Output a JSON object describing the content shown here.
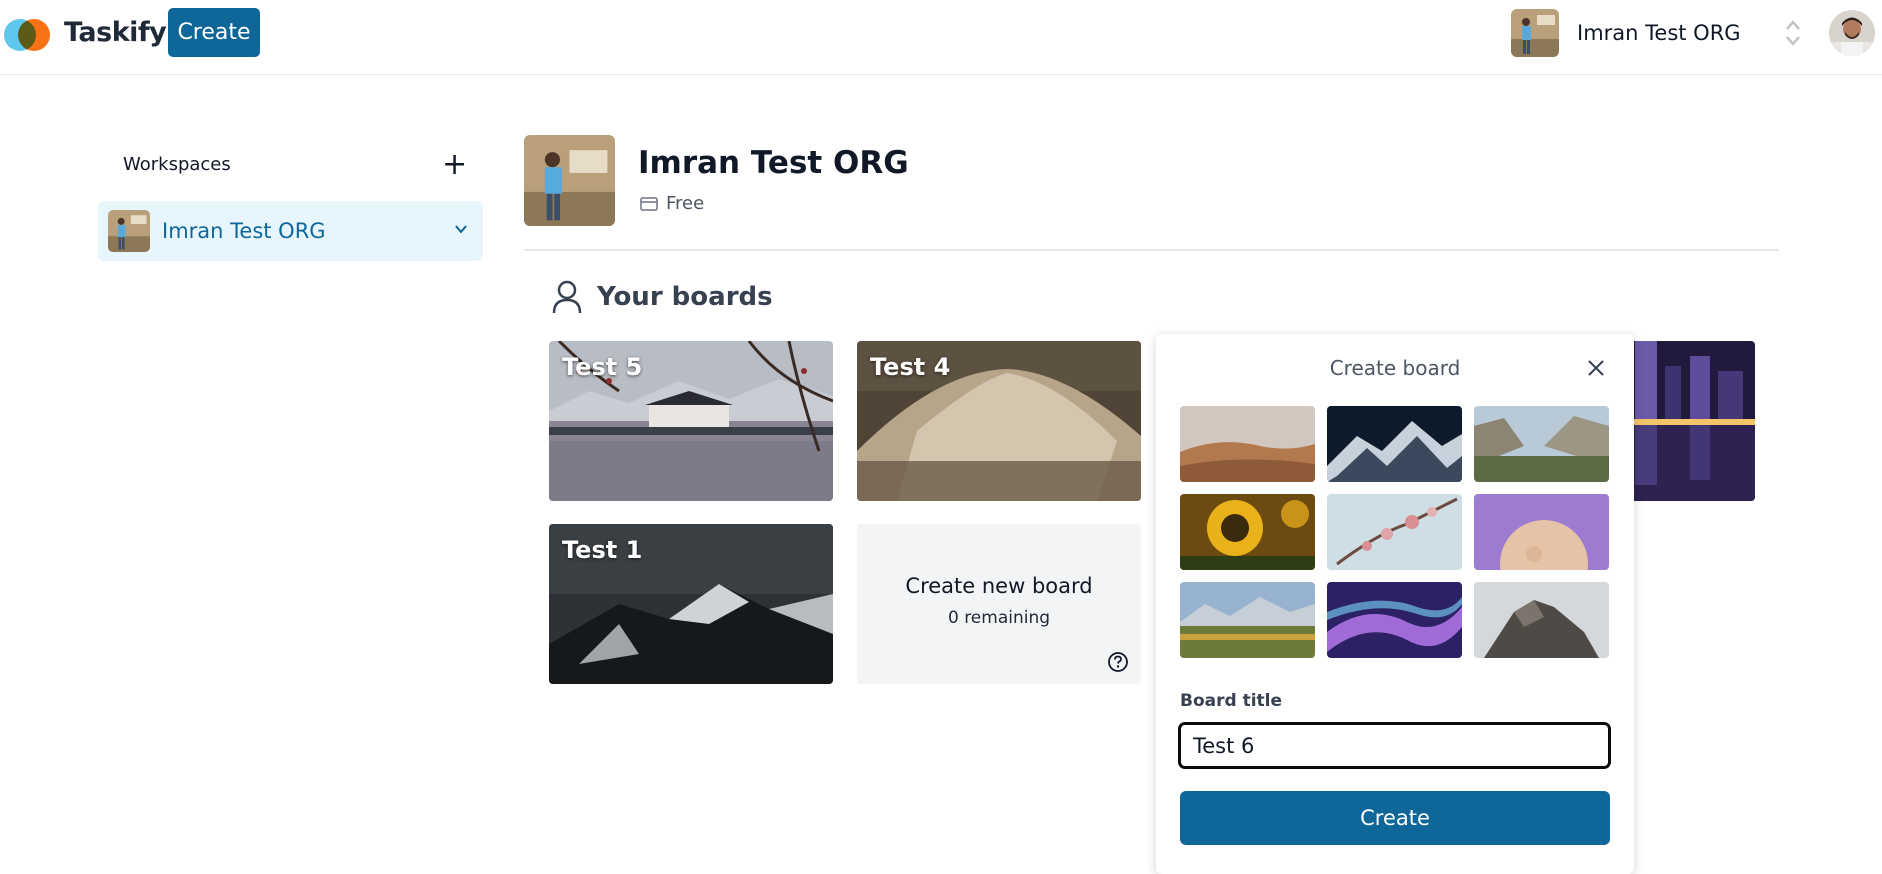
{
  "brand": {
    "name": "Taskify"
  },
  "topnav": {
    "create_label": "Create",
    "org_name": "Imran Test ORG"
  },
  "sidebar": {
    "label": "Workspaces",
    "items": [
      {
        "label": "Imran Test ORG"
      }
    ]
  },
  "header": {
    "org_name": "Imran Test ORG",
    "plan": "Free"
  },
  "boards_section": {
    "title": "Your boards",
    "boards": [
      {
        "title": "Test 5"
      },
      {
        "title": "Test 4"
      },
      {
        "title": "Test 1"
      }
    ],
    "new_board": {
      "label": "Create new board",
      "remaining": "0 remaining"
    }
  },
  "create_popover": {
    "title": "Create board",
    "board_title_label": "Board title",
    "board_title_value": "Test 6",
    "submit_label": "Create",
    "images": [
      "desert-dunes",
      "snowy-peaks-night",
      "valley-cliffs",
      "sunflower",
      "cherry-blossom",
      "purple-moon",
      "mountain-lake-sunset",
      "abstract-waves",
      "misty-rock"
    ]
  },
  "colors": {
    "primary": "#0f6699",
    "active_bg": "#e6f6fc"
  }
}
